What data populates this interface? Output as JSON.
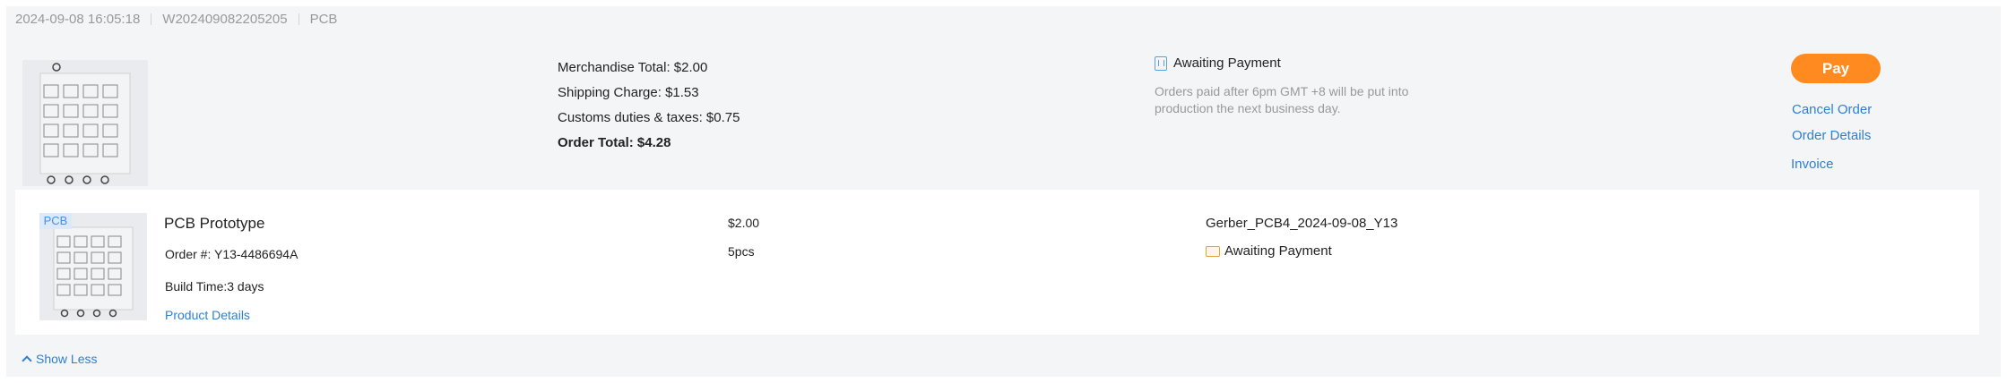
{
  "order": {
    "datetime": "2024-09-08 16:05:18",
    "number": "W202409082205205",
    "type": "PCB"
  },
  "summary": {
    "merchandise": "Merchandise Total: $2.00",
    "shipping": "Shipping Charge: $1.53",
    "duties": "Customs duties & taxes: $0.75",
    "total": "Order Total: $4.28"
  },
  "status": {
    "label": "Awaiting Payment",
    "note": "Orders paid after 6pm GMT +8 will be put into production the next business day."
  },
  "actions": {
    "pay": "Pay",
    "cancel": "Cancel Order",
    "details": "Order Details",
    "invoice": "Invoice"
  },
  "item": {
    "badge": "PCB",
    "title": "PCB Prototype",
    "order_no": "Order #: Y13-4486694A",
    "build_time": "Build Time:3 days",
    "product_details": "Product Details",
    "price": "$2.00",
    "qty": "5pcs",
    "file": "Gerber_PCB4_2024-09-08_Y13",
    "status": "Awaiting Payment"
  },
  "footer": {
    "show_less": "Show Less"
  },
  "colors": {
    "accent": "#ff8a1f",
    "link": "#2f7fd1",
    "card_bg": "#f4f5f7"
  }
}
